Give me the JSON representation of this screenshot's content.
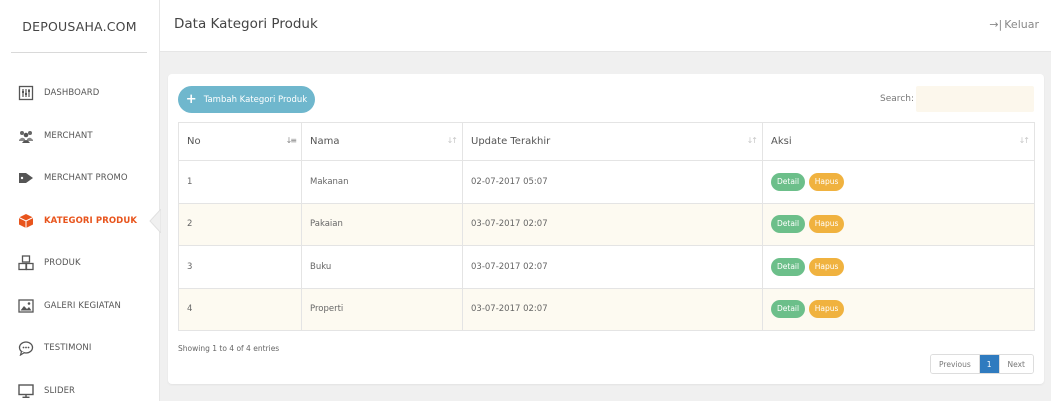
{
  "brand": "DEPOUSAHA.COM",
  "header": {
    "title": "Data Kategori Produk",
    "logout": "Keluar",
    "logout_glyph": "→|"
  },
  "sidebar": {
    "items": [
      {
        "label": "DASHBOARD",
        "icon": "dashboard-icon",
        "active": false
      },
      {
        "label": "MERCHANT",
        "icon": "users-icon",
        "active": false
      },
      {
        "label": "MERCHANT PROMO",
        "icon": "tag-icon",
        "active": false
      },
      {
        "label": "KATEGORI PRODUK",
        "icon": "box-icon",
        "active": true
      },
      {
        "label": "PRODUK",
        "icon": "boxes-icon",
        "active": false
      },
      {
        "label": "GALERI KEGIATAN",
        "icon": "image-icon",
        "active": false
      },
      {
        "label": "TESTIMONI",
        "icon": "chat-icon",
        "active": false
      },
      {
        "label": "SLIDER",
        "icon": "monitor-icon",
        "active": false
      }
    ],
    "active_color": "#e8541c"
  },
  "toolbar": {
    "add_label": "Tambah Kategori Produk",
    "search_label": "Search:",
    "search_value": ""
  },
  "table": {
    "columns": [
      "No",
      "Nama",
      "Update Terakhir",
      "Aksi"
    ],
    "rows": [
      {
        "no": "1",
        "nama": "Makanan",
        "updated": "02-07-2017 05:07"
      },
      {
        "no": "2",
        "nama": "Pakaian",
        "updated": "03-07-2017 02:07"
      },
      {
        "no": "3",
        "nama": "Buku",
        "updated": "03-07-2017 02:07"
      },
      {
        "no": "4",
        "nama": "Properti",
        "updated": "03-07-2017 02:07"
      }
    ],
    "detail_label": "Detail",
    "hapus_label": "Hapus"
  },
  "footer": {
    "info": "Showing 1 to 4 of 4 entries",
    "prev": "Previous",
    "page": "1",
    "next": "Next"
  },
  "colors": {
    "add_button": "#6fb7cd",
    "detail": "#6cbf8a",
    "hapus": "#f0b23f",
    "page_active": "#2f7bbf"
  }
}
